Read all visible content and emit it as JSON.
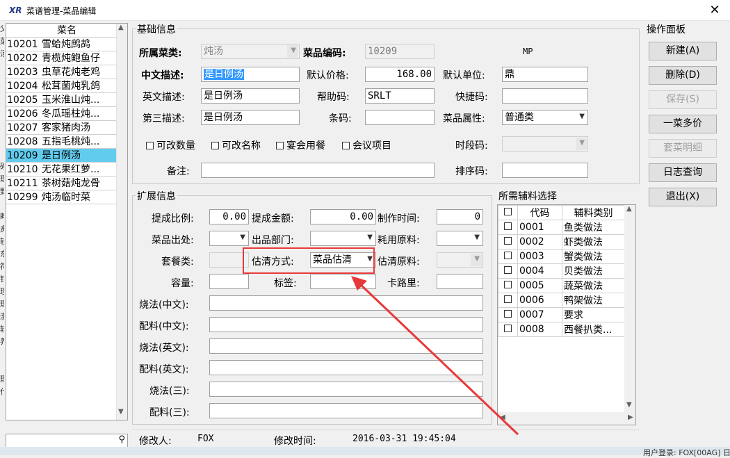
{
  "window": {
    "logo": "XR",
    "title": "菜谱管理-菜品编辑",
    "close": "✕"
  },
  "list": {
    "header": "菜名",
    "items": [
      {
        "code": "10201",
        "name": "雪蛤炖鹧鸪",
        "selected": false
      },
      {
        "code": "10202",
        "name": "青榄炖鲍鱼仔",
        "selected": false
      },
      {
        "code": "10203",
        "name": "虫草花炖老鸡",
        "selected": false
      },
      {
        "code": "10204",
        "name": "松茸菌炖乳鸽",
        "selected": false
      },
      {
        "code": "10205",
        "name": "玉米淮山炖...",
        "selected": false
      },
      {
        "code": "10206",
        "name": "冬瓜瑶柱炖...",
        "selected": false
      },
      {
        "code": "10207",
        "name": "客家猪肉汤",
        "selected": false
      },
      {
        "code": "10208",
        "name": "五指毛桃炖...",
        "selected": false
      },
      {
        "code": "10209",
        "name": "是日例汤",
        "selected": true
      },
      {
        "code": "10210",
        "name": "无花果红萝...",
        "selected": false
      },
      {
        "code": "10211",
        "name": "茶树菇炖龙骨",
        "selected": false
      },
      {
        "code": "10299",
        "name": "炖汤临时菜",
        "selected": false
      }
    ],
    "search_icon": "search-icon",
    "search_glyph": "⚲"
  },
  "edge_text": "父\n菜\n汤\n\n\n\n\n\n\n\n\n砌\n理\n野\n\n睥\n炙\n较\n东\n符\n钉\n理\n理\n渤\n较\n养\n\n\n理\n代",
  "basic": {
    "title": "基础信息",
    "category_label": "所属菜类:",
    "category_value": "炖汤",
    "code_label": "菜品编码:",
    "code_value": "10209",
    "mp": "MP",
    "cn_desc_label": "中文描述:",
    "cn_desc_value": "是日例汤",
    "price_label": "默认价格:",
    "price_value": "168.00",
    "unit_label": "默认单位:",
    "unit_value": "鼎",
    "en_desc_label": "英文描述:",
    "en_desc_value": "是日例汤",
    "help_label": "帮助码:",
    "help_value": "SRLT",
    "quick_label": "快捷码:",
    "quick_value": "",
    "third_desc_label": "第三描述:",
    "third_desc_value": "是日例汤",
    "barcode_label": "条码:",
    "barcode_value": "",
    "attr_label": "菜品属性:",
    "attr_value": "普通类",
    "checkboxes": [
      "可改数量",
      "可改名称",
      "宴会用餐",
      "会议项目"
    ],
    "period_label": "时段码:",
    "period_value": "",
    "remark_label": "备注:",
    "remark_value": "",
    "sort_label": "排序码:",
    "sort_value": ""
  },
  "ext": {
    "title": "扩展信息",
    "ratio_label": "提成比例:",
    "ratio_value": "0.00",
    "amount_label": "提成金额:",
    "amount_value": "0.00",
    "time_label": "制作时间:",
    "time_value": "0",
    "origin_label": "菜品出处:",
    "dept_label": "出品部门:",
    "material_label": "耗用原料:",
    "combo_label": "套餐类:",
    "estimate_label": "估清方式:",
    "estimate_value": "菜品估清",
    "est_material_label": "估清原料:",
    "capacity_label": "容量:",
    "tag_label": "标签:",
    "calorie_label": "卡路里:",
    "cook_cn_label": "烧法(中文):",
    "mix_cn_label": "配料(中文):",
    "cook_en_label": "烧法(英文):",
    "mix_en_label": "配料(英文):",
    "cook_3_label": "烧法(三):",
    "mix_3_label": "配料(三):"
  },
  "aux": {
    "title": "所需辅料选择",
    "headers": [
      "代码",
      "辅料类别"
    ],
    "rows": [
      {
        "code": "0001",
        "name": "鱼类做法"
      },
      {
        "code": "0002",
        "name": "虾类做法"
      },
      {
        "code": "0003",
        "name": "蟹类做法"
      },
      {
        "code": "0004",
        "name": "贝类做法"
      },
      {
        "code": "0005",
        "name": "蔬菜做法"
      },
      {
        "code": "0006",
        "name": "鸭架做法"
      },
      {
        "code": "0007",
        "name": "要求"
      },
      {
        "code": "0008",
        "name": "西餐扒类..."
      }
    ]
  },
  "panel": {
    "title": "操作面板",
    "buttons": [
      {
        "label": "新建(A)",
        "enabled": true
      },
      {
        "label": "删除(D)",
        "enabled": true
      },
      {
        "label": "保存(S)",
        "enabled": false
      },
      {
        "label": "一菜多价",
        "enabled": true
      },
      {
        "label": "套菜明细",
        "enabled": false
      },
      {
        "label": "日志查询",
        "enabled": true
      },
      {
        "label": "退出(X)",
        "enabled": true
      }
    ]
  },
  "footer": {
    "modifier_label": "修改人:",
    "modifier_value": "FOX",
    "mtime_label": "修改时间:",
    "mtime_value": "2016-03-31 19:45:04",
    "status_text": "用户登录: FOX[00AG] 日"
  },
  "annotation_color": "#e8393a",
  "selection_color": "#62ccef"
}
